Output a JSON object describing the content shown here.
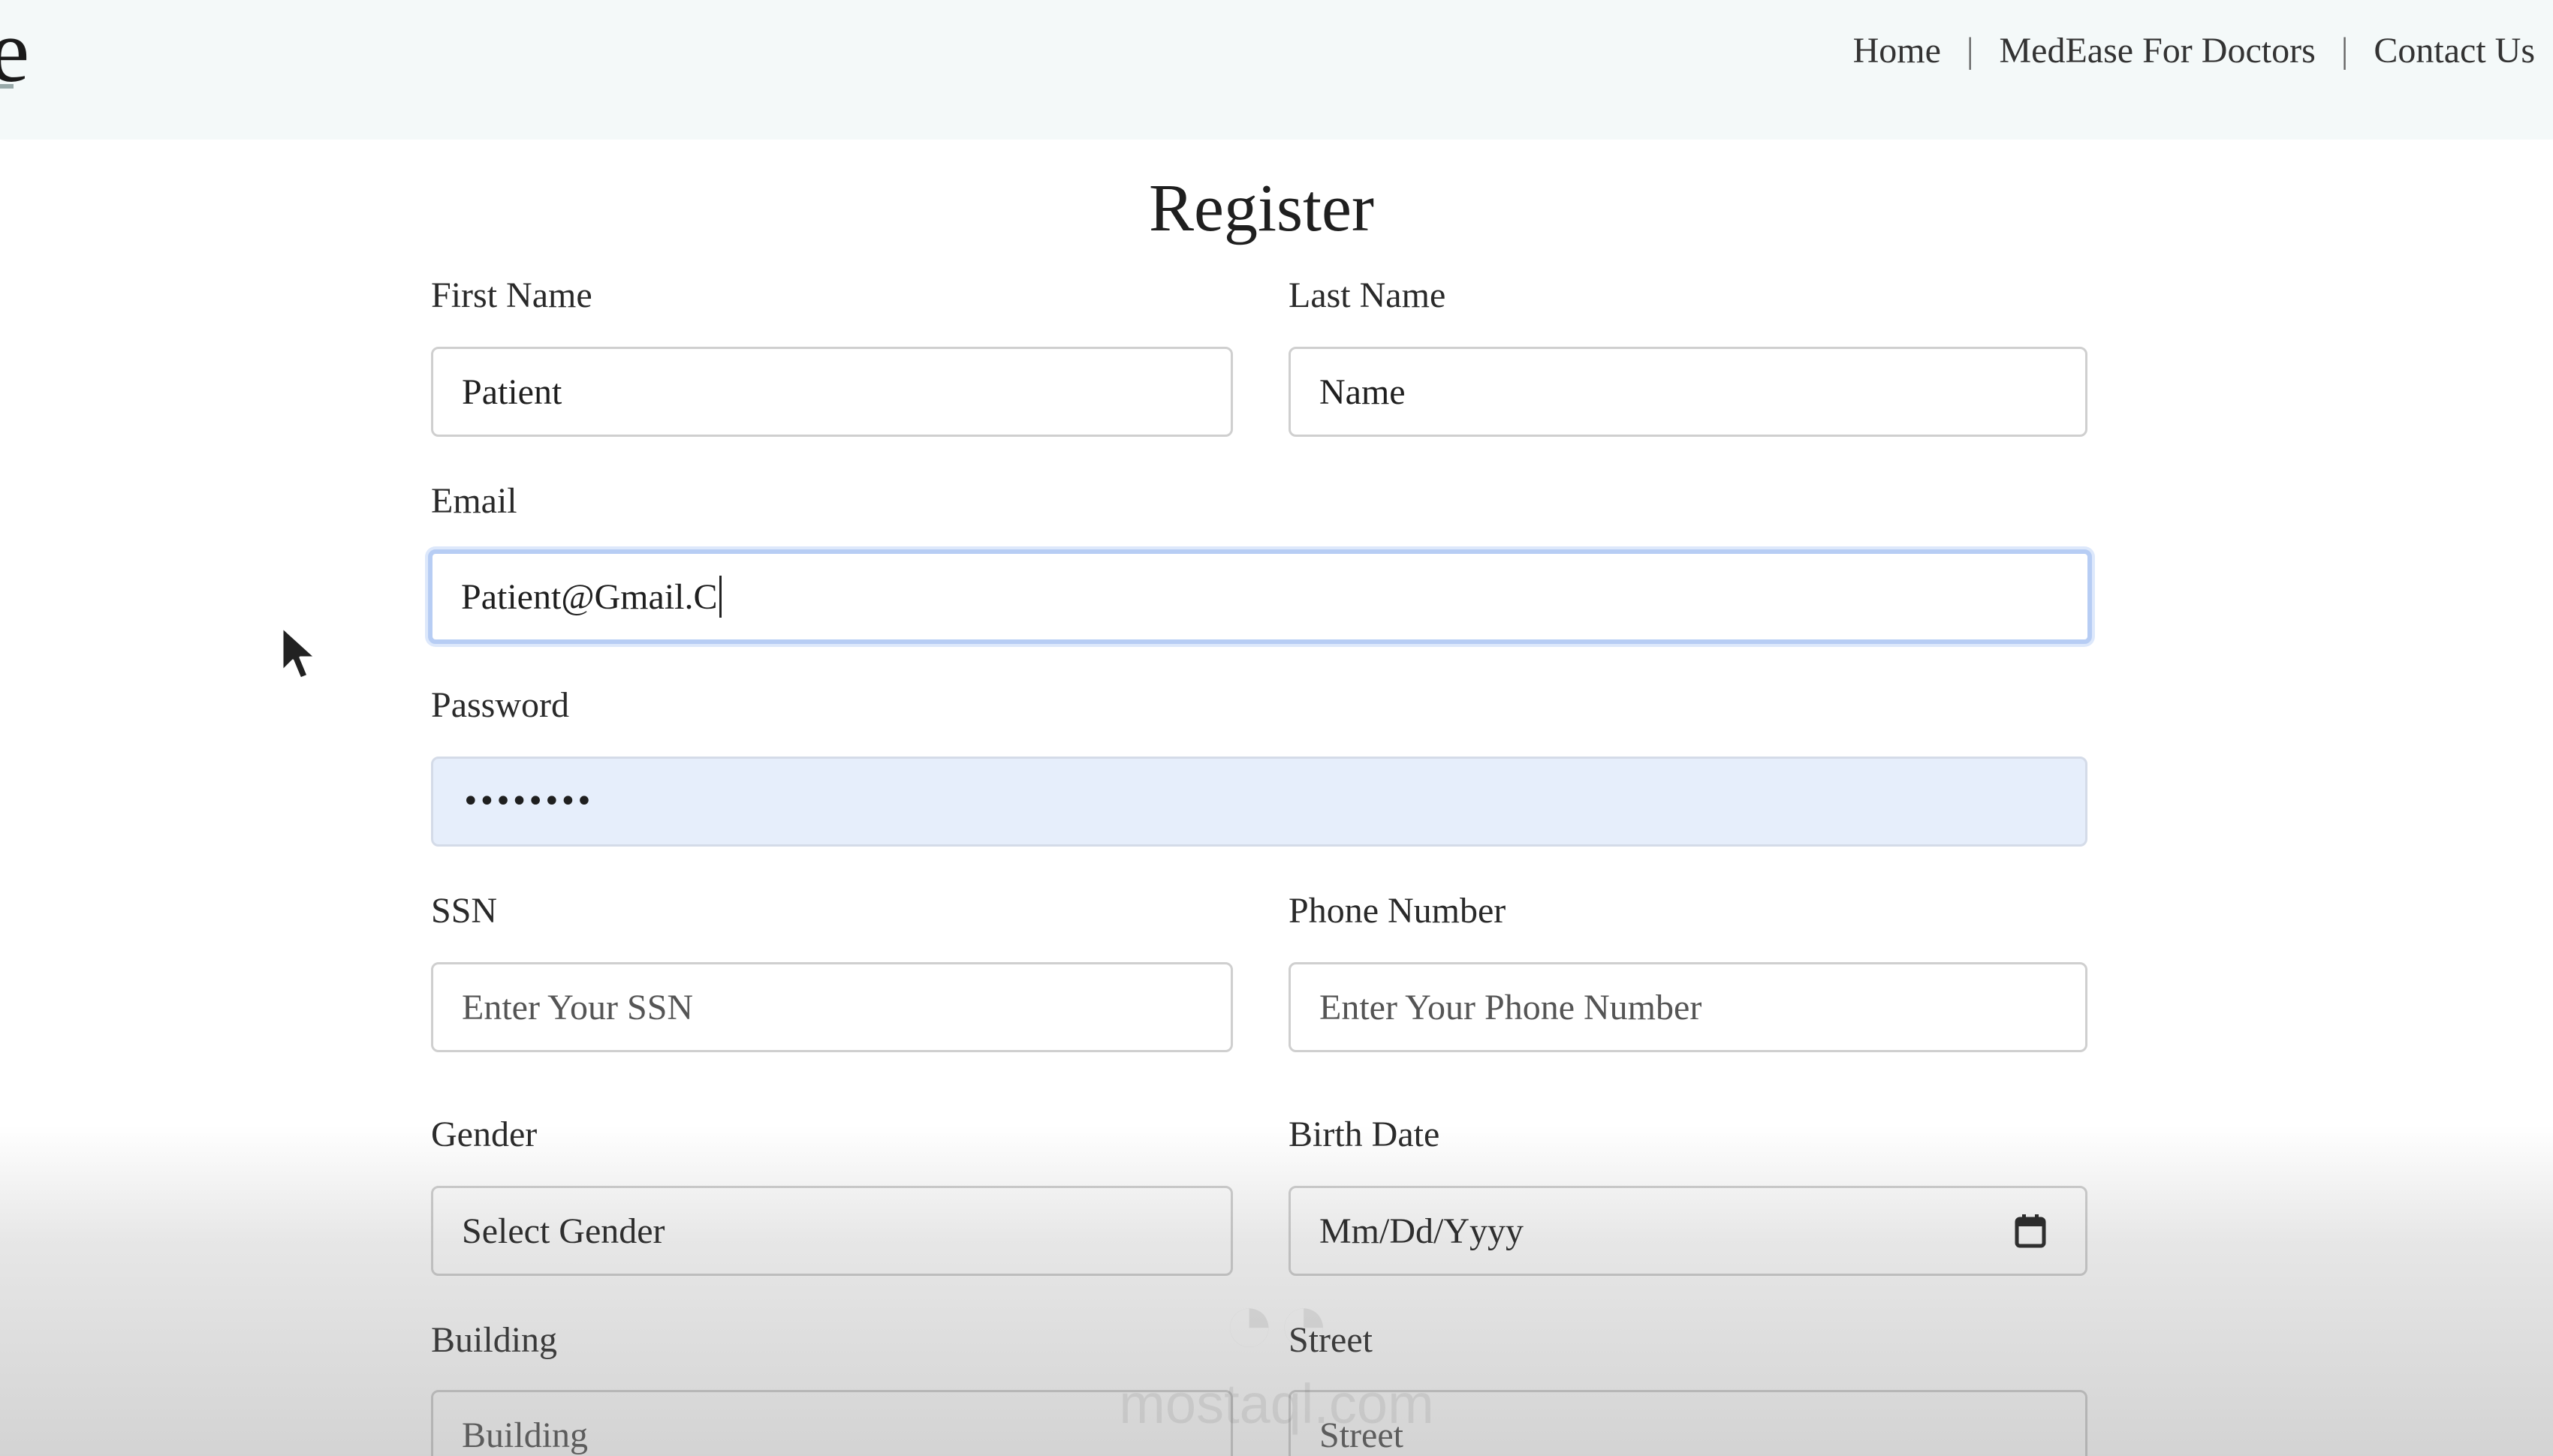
{
  "header": {
    "logo_text": "e",
    "nav": [
      {
        "label": "Home"
      },
      {
        "label": "MedEase For Doctors"
      },
      {
        "label": "Contact Us"
      }
    ],
    "separator": "|"
  },
  "form": {
    "title": "Register",
    "first_name": {
      "label": "First Name",
      "value": "Patient"
    },
    "last_name": {
      "label": "Last Name",
      "value": "Name"
    },
    "email": {
      "label": "Email",
      "value": "Patient@Gmail.C"
    },
    "password": {
      "label": "Password",
      "value": "••••••••"
    },
    "ssn": {
      "label": "SSN",
      "placeholder": "Enter Your SSN"
    },
    "phone": {
      "label": "Phone Number",
      "placeholder": "Enter Your Phone Number"
    },
    "gender": {
      "label": "Gender",
      "value": "Select Gender"
    },
    "birth_date": {
      "label": "Birth Date",
      "placeholder": "Mm/Dd/Yyyy"
    },
    "building": {
      "label": "Building",
      "placeholder": "Building"
    },
    "street": {
      "label": "Street",
      "placeholder": "Street"
    }
  },
  "watermark": {
    "text": "mostaql.com"
  },
  "colors": {
    "header_bg": "#f4f9f9",
    "focus_ring": "#b7cdf4",
    "autofill_bg": "#e6eefb"
  },
  "icons": {
    "calendar": "calendar-icon",
    "cursor": "mouse-pointer-icon"
  }
}
